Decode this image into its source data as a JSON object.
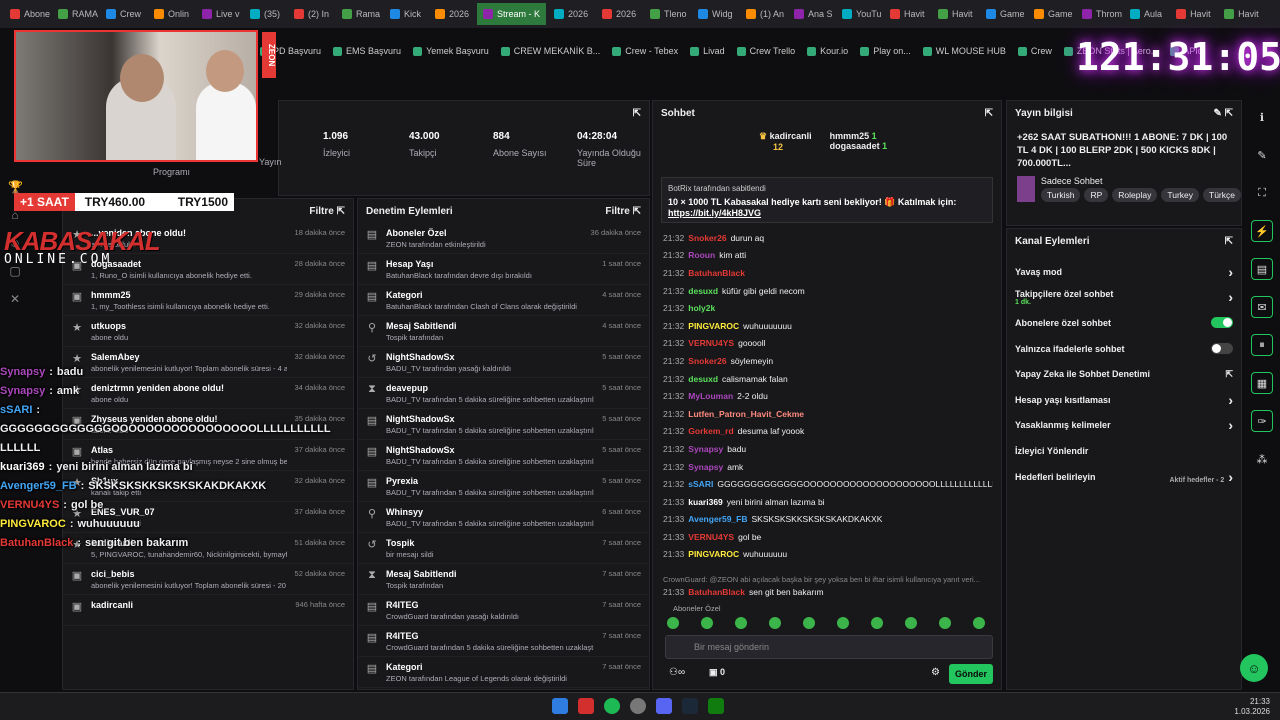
{
  "tabs": [
    "Abone",
    "RAMA",
    "Crew",
    "Onlin",
    "Live v",
    "(35)",
    "(2) In",
    "Rama",
    "Kick",
    "2026",
    "Stream - K",
    "2026",
    "2026",
    "Tleno",
    "Widg",
    "(1) An",
    "Ana S",
    "YouTu",
    "Havit",
    "Havit",
    "Game",
    "Game",
    "Throm",
    "Aula",
    "Havit",
    "Havit"
  ],
  "bookmarks": [
    "PD Başvuru",
    "EMS Başvuru",
    "Yemek Başvuru",
    "CREW MEKANİK B...",
    "Crew - Tebex",
    "Livad",
    "Crew Trello",
    "Kour.io",
    "Play on...",
    "WL MOUSE HUB",
    "Crew",
    "ZEON Stats | Aero...",
    "APIq"
  ],
  "timer": "121:31:05",
  "overlay": {
    "zeon": "ZEON",
    "saat": "+1 SAAT",
    "try1": "TRY460.00",
    "try2": "TRY1500",
    "brand": "KABASAKAL",
    "brand_sub": "ONLINE.COM"
  },
  "stats": {
    "program": "Programı",
    "yayin": "Yayın",
    "izleyici_val": "1.096",
    "izleyici": "İzleyici",
    "takipci_val": "43.000",
    "takipci": "Takipçi",
    "abone_val": "884",
    "abone": "Abone Sayısı",
    "sure_val": "04:28:04",
    "sure": "Yayında Olduğu Süre"
  },
  "activity": {
    "filter": "Filtre",
    "rows": [
      {
        "t": "...yeniden abone oldu!",
        "s": "abone oldular",
        "time": "18 dakika önce"
      },
      {
        "t": "dogasaadet",
        "s": "1, Runo_O isimli kullanıcıya abonelik hediye etti.",
        "time": "28 dakika önce"
      },
      {
        "t": "hmmm25",
        "s": "1, my_Toothless isimli kullanıcıya abonelik hediye etti.",
        "time": "29 dakika önce"
      },
      {
        "t": "utkuops",
        "s": "abone oldu",
        "time": "32 dakika önce"
      },
      {
        "t": "SalemAbey",
        "s": "abonelik yenilemesini kutluyor! Toplam abonelik süresi - 4 ay!",
        "time": "32 dakika önce"
      },
      {
        "t": "deniztrmn yeniden abone oldu!",
        "s": "abone oldu",
        "time": "34 dakika önce"
      },
      {
        "t": "Zhyseus yeniden abone oldu!",
        "s": "abone oldu",
        "time": "35 dakika önce"
      },
      {
        "t": "Atlas",
        "s": "bende habersiz dün gece paylaşmış neyse 2 sine olmuş be",
        "time": "37 dakika önce"
      },
      {
        "t": "Sh1ux",
        "s": "kanalı takip etti",
        "time": "32 dakika önce"
      },
      {
        "t": "ENES_VUR_07",
        "s": "kanalı takip etti",
        "time": "37 dakika önce"
      },
      {
        "t": "kadircanli",
        "s": "5, PINGVAROC, tunahandemir60, Nickinilgimicekti, bymayfe, dogasaadet",
        "time": "51 dakika önce"
      },
      {
        "t": "cici_bebis",
        "s": "abonelik yenilemesini kutluyor! Toplam abonelik süresi - 20 ay!",
        "time": "52 dakika önce"
      },
      {
        "t": "kadircanli",
        "s": "",
        "time": "946 hafta önce"
      }
    ]
  },
  "moderation": {
    "title": "Denetim Eylemleri",
    "filter": "Filtre",
    "rows": [
      {
        "t": "Aboneler Özel",
        "s": "ZEON tarafından etkinleştirildi",
        "time": "36 dakika önce"
      },
      {
        "t": "Hesap Yaşı",
        "s": "BatuhanBlack tarafından devre dışı bırakıldı",
        "time": "1 saat önce"
      },
      {
        "t": "Kategori",
        "s": "BatuhanBlack tarafından Clash of Clans olarak değiştirildi",
        "time": "4 saat önce"
      },
      {
        "t": "Mesaj Sabitlendi",
        "s": "Tospik tarafından",
        "time": "4 saat önce"
      },
      {
        "t": "NightShadowSx",
        "s": "BADU_TV tarafından yasağı kaldırıldı",
        "time": "5 saat önce"
      },
      {
        "t": "deavepup",
        "s": "BADU_TV tarafından 5 dakika süreliğine sohbetten uzaklaştırıldı",
        "time": "5 saat önce"
      },
      {
        "t": "NightShadowSx",
        "s": "BADU_TV tarafından 5 dakika süreliğine sohbetten uzaklaştırıldı",
        "time": "5 saat önce"
      },
      {
        "t": "NightShadowSx",
        "s": "BADU_TV tarafından 5 dakika süreliğine sohbetten uzaklaştırıldı",
        "time": "5 saat önce"
      },
      {
        "t": "Pyrexia",
        "s": "BADU_TV tarafından 5 dakika süreliğine sohbetten uzaklaştırıldı",
        "time": "5 saat önce"
      },
      {
        "t": "Whinsyy",
        "s": "BADU_TV tarafından 5 dakika süreliğine sohbetten uzaklaştırıldı",
        "time": "6 saat önce"
      },
      {
        "t": "Tospik",
        "s": "bir mesajı sildi",
        "time": "7 saat önce"
      },
      {
        "t": "Mesaj Sabitlendi",
        "s": "Tospik tarafından",
        "time": "7 saat önce"
      },
      {
        "t": "R4ITEG",
        "s": "CrowdGuard tarafından yasağı kaldırıldı",
        "time": "7 saat önce"
      },
      {
        "t": "R4ITEG",
        "s": "CrowdGuard tarafından 5 dakika süreliğine sohbetten uzaklaştırıldı",
        "time": "7 saat önce"
      },
      {
        "t": "Kategori",
        "s": "ZEON tarafından League of Legends olarak değiştirildi",
        "time": "7 saat önce"
      }
    ]
  },
  "chat": {
    "title": "Sohbet",
    "top1": "kadircanli",
    "top1c": "12",
    "top2": "hmmm25",
    "top2c": "1",
    "top3": "dogasaadet",
    "top3c": "1",
    "pinned_by": "BotRix tarafından sabitlendi",
    "pinned_text": "10 × 1000 TL Kabasakal hediye kartı seni bekliyor! 🎁 Katılmak için:",
    "pinned_link": "https://bit.ly/4kH8JVG",
    "messages": [
      {
        "t": "21:32",
        "u": "Snoker26",
        "m": "durun aq",
        "c": "#e53935"
      },
      {
        "t": "21:32",
        "u": "Rooun",
        "m": "kim atti",
        "c": "#ab47bc"
      },
      {
        "t": "21:32",
        "u": "BatuhanBlack",
        "m": "",
        "c": "#e53935"
      },
      {
        "t": "21:32",
        "u": "desuxd",
        "m": "küfür gibi geldi necom",
        "c": "#5be05b"
      },
      {
        "t": "21:32",
        "u": "holy2k",
        "m": "",
        "c": "#5be05b"
      },
      {
        "t": "21:32",
        "u": "PINGVAROC",
        "m": "wuhuuuuuuu",
        "c": "#ffeb3b"
      },
      {
        "t": "21:32",
        "u": "VERNU4YS",
        "m": "gooooll",
        "c": "#e53935"
      },
      {
        "t": "21:32",
        "u": "Snoker26",
        "m": "söylemeyin",
        "c": "#e53935"
      },
      {
        "t": "21:32",
        "u": "desuxd",
        "m": "calismamak falan",
        "c": "#5be05b"
      },
      {
        "t": "21:32",
        "u": "MyLouman",
        "m": "2-2 oldu",
        "c": "#ab47bc"
      },
      {
        "t": "21:32",
        "u": "Lutfen_Patron_Havit_Cekme",
        "m": "",
        "c": "#ff8a80"
      },
      {
        "t": "21:32",
        "u": "Gorkem_rd",
        "m": "desuma laf yoook",
        "c": "#e53935"
      },
      {
        "t": "21:32",
        "u": "Synapsy",
        "m": "badu",
        "c": "#ab47bc"
      },
      {
        "t": "21:32",
        "u": "Synapsy",
        "m": "amk",
        "c": "#ab47bc"
      },
      {
        "t": "21:32",
        "u": "sSARI",
        "m": "GGGGGGGGGGGGGOOOOOOOOOOOOOOOOOOOOLLLLLLLLLLLLLLLLLLLLLL",
        "c": "#42a5f5"
      },
      {
        "t": "21:33",
        "u": "kuari369",
        "m": "yeni birini alman lazımа bi",
        "c": "#fff"
      },
      {
        "t": "21:33",
        "u": "Avenger59_FB",
        "m": "SKSKSKSKKSKSKSKAKDKAKXK",
        "c": "#42a5f5"
      },
      {
        "t": "21:33",
        "u": "VERNU4YS",
        "m": "gol be",
        "c": "#e53935"
      },
      {
        "t": "21:33",
        "u": "PINGVAROC",
        "m": "wuhuuuuuu",
        "c": "#ffeb3b"
      }
    ],
    "reply": "CrownGuard: @ZEON abi açılacak başka bir şey yoksa ben bi iftar isimli kullanıcıya yanıt veri...",
    "last": {
      "t": "21:33",
      "u": "BatuhanBlack",
      "m": "sen git ben bakarım",
      "c": "#e53935"
    },
    "sub_only": "Aboneler Özel",
    "placeholder": "Bir mesaj gönderin",
    "send": "Gönder",
    "count": "0"
  },
  "info": {
    "title": "Yayın bilgisi",
    "stream_title": "+262 SAAT SUBATHON!!! 1 ABONE: 7 DK | 100 TL 4 DK | 100 BLERP 2DK | 500 KICKS 8DK | 700.000TL...",
    "category": "Sadece Sohbet",
    "tags": [
      "Turkish",
      "RP",
      "Roleplay",
      "Turkey",
      "Türkçe"
    ]
  },
  "kanal": {
    "title": "Kanal Eylemleri",
    "rows": [
      {
        "l": "Yavaş mod",
        "kind": "arrow"
      },
      {
        "l": "Takipçilere özel sohbet",
        "sub": "1 dk.",
        "kind": "arrow"
      },
      {
        "l": "Abonelere özel sohbet",
        "kind": "on"
      },
      {
        "l": "Yalnızca ifadelerle sohbet",
        "kind": "off"
      },
      {
        "l": "Yapay Zeka ile Sohbet Denetimi",
        "kind": "ext"
      },
      {
        "l": "Hesap yaşı kısıtlaması",
        "kind": "arrow"
      },
      {
        "l": "Yasaklanmış kelimeler",
        "kind": "arrow"
      },
      {
        "l": "İzleyici Yönlendir",
        "kind": "none"
      },
      {
        "l": "Hedefleri belirleyin",
        "sub2": "Aktif hedefler - 2",
        "kind": "arrow"
      }
    ]
  },
  "overlay_chat": [
    {
      "u": "Synapsy",
      "m": "badu",
      "c": "#ab47bc"
    },
    {
      "u": "Synapsy",
      "m": "amk",
      "c": "#ab47bc"
    },
    {
      "u": "sSARI",
      "m": "",
      "c": "#42a5f5"
    },
    {
      "u": "",
      "m": "GGGGGGGGGGGGGOOOOOOOOOOOOOOOOOLLLLLLLLLLL",
      "c": "#fff"
    },
    {
      "u": "",
      "m": "LLLLLL",
      "c": "#fff"
    },
    {
      "u": "kuari369",
      "m": "yeni birini alman lazıma bi",
      "c": "#fff"
    },
    {
      "u": "Avenger59_FB",
      "m": "SKSKSKSKKSKSKSKAKDKAKXK",
      "c": "#42a5f5"
    },
    {
      "u": "VERNU4YS",
      "m": "gol be",
      "c": "#e53935"
    },
    {
      "u": "PINGVAROC",
      "m": "wuhuuuuuu",
      "c": "#ffeb3b"
    },
    {
      "u": "BatuhanBlack",
      "m": "sen git ben bakarım",
      "c": "#e53935"
    }
  ],
  "clock": {
    "time": "21:33",
    "date": "1.03.2026"
  }
}
